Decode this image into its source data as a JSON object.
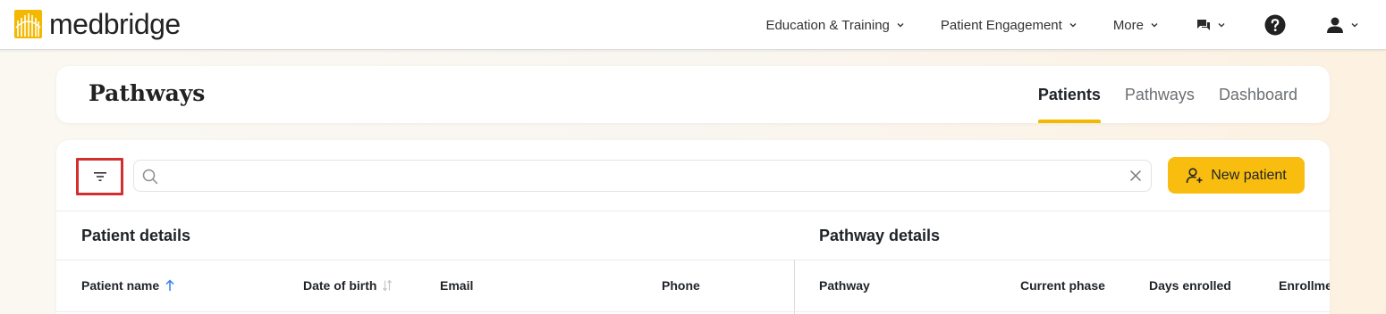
{
  "brand": {
    "name": "medbridge",
    "logo_color": "#f5b800"
  },
  "nav": {
    "items": [
      {
        "label": "Education & Training",
        "icon": "chevron-down-icon"
      },
      {
        "label": "Patient Engagement",
        "icon": "chevron-down-icon"
      },
      {
        "label": "More",
        "icon": "chevron-down-icon"
      }
    ],
    "messages_icon": "chat-icon",
    "help_icon": "help-icon",
    "account_icon": "user-icon"
  },
  "header": {
    "title": "Pathways",
    "tabs": [
      {
        "label": "Patients",
        "active": true
      },
      {
        "label": "Pathways",
        "active": false
      },
      {
        "label": "Dashboard",
        "active": false
      }
    ]
  },
  "toolbar": {
    "filter_icon": "filter-icon",
    "search_value": "",
    "search_placeholder": "",
    "new_patient_label": "New patient"
  },
  "table": {
    "patient_section": "Patient details",
    "pathway_section": "Pathway details",
    "columns": [
      {
        "label": "Patient name",
        "sort": "ascending"
      },
      {
        "label": "Date of birth",
        "sort": "sortable"
      },
      {
        "label": "Email",
        "sort": "none"
      },
      {
        "label": "Phone",
        "sort": "none"
      },
      {
        "label": "Pathway",
        "sort": "none"
      },
      {
        "label": "Current phase",
        "sort": "none"
      },
      {
        "label": "Days enrolled",
        "sort": "none"
      },
      {
        "label": "Enrollme",
        "sort": "none"
      }
    ]
  },
  "colors": {
    "accent": "#f9bd0f",
    "sort_active": "#2f80ed",
    "highlight": "#d32f2f"
  }
}
